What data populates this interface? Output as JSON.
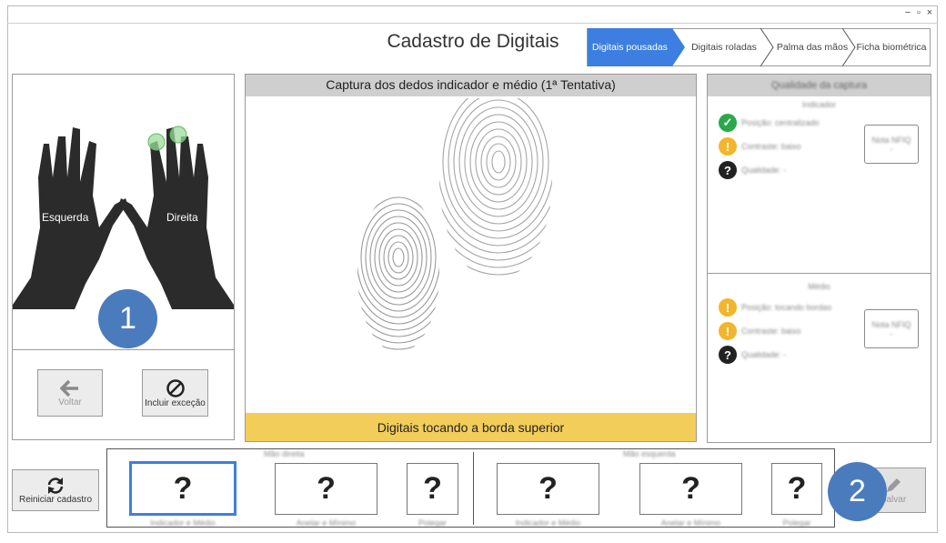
{
  "window": {
    "title": "Cadastro de Digitais",
    "controls": {
      "minimize": "−",
      "maximize": "▫",
      "close": "×"
    }
  },
  "steps": [
    {
      "label": "Digitais pousadas",
      "active": true
    },
    {
      "label": "Digitais roladas",
      "active": false
    },
    {
      "label": "Palma das mãos",
      "active": false
    },
    {
      "label": "Ficha biométrica",
      "active": false
    }
  ],
  "hands": {
    "left_label": "Esquerda",
    "right_label": "Direita",
    "badge": "1"
  },
  "left_buttons": {
    "back": "Voltar",
    "exception": "Incluir exceção"
  },
  "capture": {
    "header": "Captura dos dedos indicador e médio (1ª Tentativa)",
    "status": "Digitais tocando a borda superior"
  },
  "quality": {
    "header": "Qualidade da captura",
    "indicator": {
      "title": "Indicador",
      "items": [
        {
          "icon": "check-icon",
          "text": "Posição: centralizado"
        },
        {
          "icon": "warning-icon",
          "text": "Contraste: baixo"
        },
        {
          "icon": "question-icon",
          "text": "Qualidade: -"
        }
      ],
      "nfiq_label": "Nota NFIQ",
      "nfiq_value": "-"
    },
    "middle": {
      "title": "Médio",
      "items": [
        {
          "icon": "warning-icon",
          "text": "Posição: tocando bordas"
        },
        {
          "icon": "warning-icon",
          "text": "Contraste: baixo"
        },
        {
          "icon": "question-icon",
          "text": "Qualidade: -"
        }
      ],
      "nfiq_label": "Nota NFIQ",
      "nfiq_value": "-"
    }
  },
  "bottom": {
    "restart": "Reiniciar cadastro",
    "right_hand_title": "Mão direita",
    "left_hand_title": "Mão esquerda",
    "right_slots": [
      {
        "caption": "Indicador e Médio",
        "mark": "?"
      },
      {
        "caption": "Anelar e Mínimo",
        "mark": "?"
      },
      {
        "caption": "Polegar",
        "mark": "?"
      }
    ],
    "left_slots": [
      {
        "caption": "Indicador e Médio",
        "mark": "?"
      },
      {
        "caption": "Anelar e Mínimo",
        "mark": "?"
      },
      {
        "caption": "Polegar",
        "mark": "?"
      }
    ],
    "save": "Salvar",
    "badge": "2"
  },
  "colors": {
    "accent": "#3d7fe0",
    "status_bar": "#f2cd59",
    "badge": "#4a7bbd",
    "ok": "#2aa84a",
    "warn": "#f2b62c"
  }
}
